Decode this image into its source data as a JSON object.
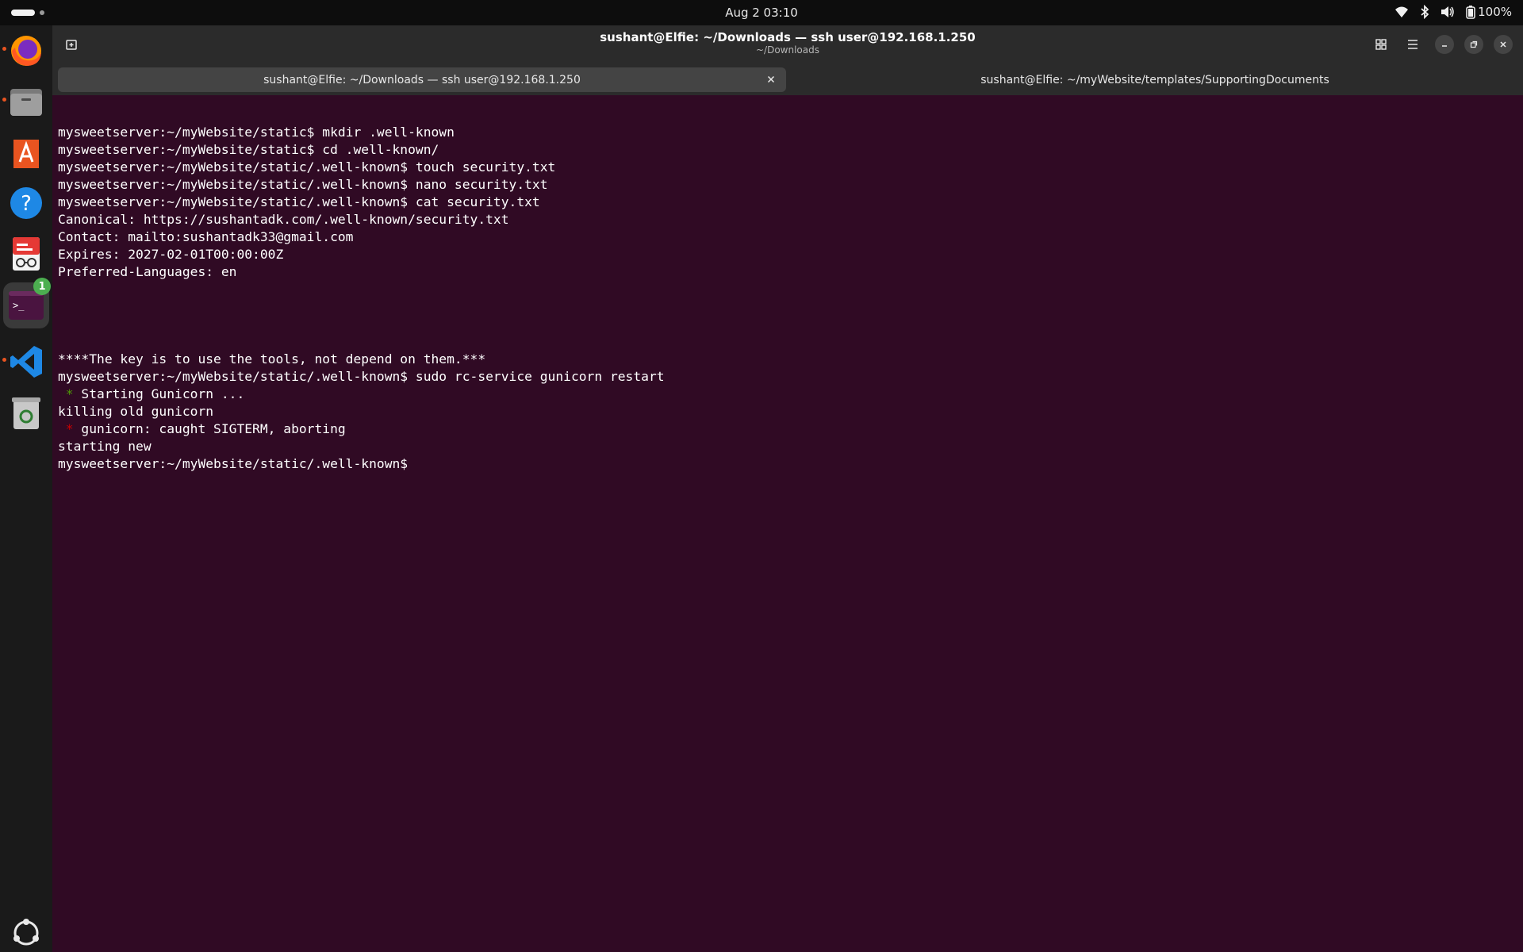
{
  "topbar": {
    "clock": "Aug 2  03:10",
    "battery_label": "100%",
    "icons": [
      "activities-indicator",
      "wifi-icon",
      "bluetooth-icon",
      "volume-icon",
      "battery-icon"
    ]
  },
  "dock": {
    "apps": [
      {
        "name": "firefox-icon",
        "running": true
      },
      {
        "name": "files-icon",
        "running": true
      },
      {
        "name": "app-center-icon",
        "running": false
      },
      {
        "name": "help-icon",
        "running": false
      },
      {
        "name": "document-viewer-icon",
        "running": false
      },
      {
        "name": "terminal-icon",
        "running": true,
        "badge": "1"
      },
      {
        "name": "vscode-icon",
        "running": true
      },
      {
        "name": "trash-icon",
        "running": false
      }
    ],
    "bottom": "ubuntu-apps-grid-icon"
  },
  "window": {
    "title": "sushant@Elfie: ~/Downloads — ssh user@192.168.1.250",
    "subtitle": "~/Downloads",
    "tabs": [
      {
        "label": "sushant@Elfie: ~/Downloads — ssh user@192.168.1.250",
        "active": true
      },
      {
        "label": "sushant@Elfie: ~/myWebsite/templates/SupportingDocuments",
        "active": false
      }
    ]
  },
  "terminal": {
    "colors": {
      "background": "#300a24",
      "text": "#ffffff",
      "green": "#4e9a06",
      "red": "#cc0000"
    },
    "lines": [
      "mysweetserver:~/myWebsite/static$ mkdir .well-known",
      "mysweetserver:~/myWebsite/static$ cd .well-known/",
      "mysweetserver:~/myWebsite/static/.well-known$ touch security.txt",
      "mysweetserver:~/myWebsite/static/.well-known$ nano security.txt",
      "mysweetserver:~/myWebsite/static/.well-known$ cat security.txt",
      "Canonical: https://sushantadk.com/.well-known/security.txt",
      "Contact: mailto:sushantadk33@gmail.com",
      "Expires: 2027-02-01T00:00:00Z",
      "Preferred-Languages: en",
      "",
      "",
      "",
      "",
      "****The key is to use the tools, not depend on them.***",
      "mysweetserver:~/myWebsite/static/.well-known$ sudo rc-service gunicorn restart",
      " * Starting Gunicorn ...",
      "killing old gunicorn",
      " * gunicorn: caught SIGTERM, aborting",
      "starting new",
      "mysweetserver:~/myWebsite/static/.well-known$ "
    ],
    "green_star_line": 15,
    "red_star_line": 17
  }
}
